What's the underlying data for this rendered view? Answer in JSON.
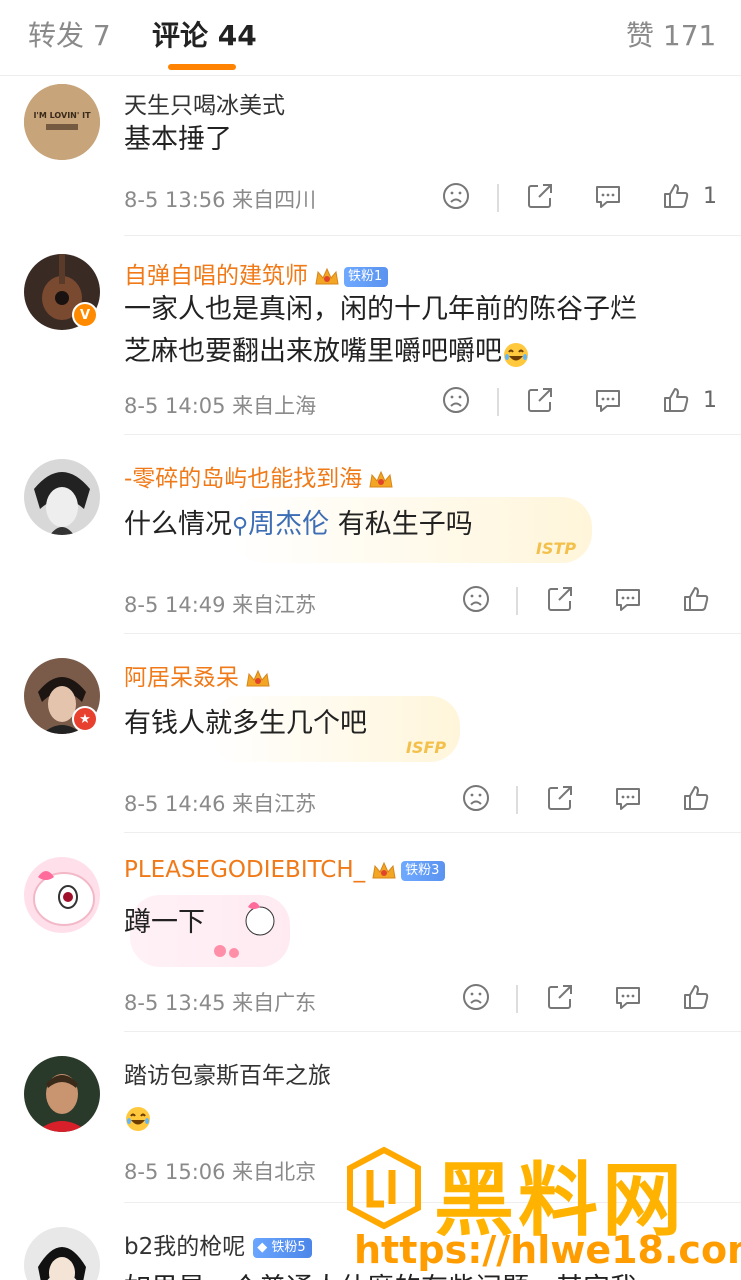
{
  "tabs": {
    "repost": "转发 7",
    "comments": "评论 44",
    "likes": "赞 171"
  },
  "comments": [
    {
      "name": "天生只喝冰美式",
      "body": "基本捶了",
      "meta": "8-5 13:56  来自四川",
      "likes": "1",
      "avatar_text": "I'M LOVIN' IT"
    },
    {
      "name": "自弹自唱的建筑师",
      "badge": "铁粉1",
      "body_line1": "一家人也是真闲，闲的十几年前的陈谷子烂",
      "body_line2": "芝麻也要翻出来放嘴里嚼吧嚼吧",
      "meta": "8-5 14:05  来自上海",
      "likes": "1",
      "avatar_badge": "V"
    },
    {
      "name": "-零碎的岛屿也能找到海",
      "body_pre": "什么情况",
      "topic": "周杰伦",
      "body_post": " 有私生子吗",
      "meta": "8-5 14:49  来自江苏",
      "mbti": "ISTP"
    },
    {
      "name": "阿居呆叒呆",
      "body": "有钱人就多生几个吧",
      "meta": "8-5 14:46  来自江苏",
      "mbti": "ISFP"
    },
    {
      "name": "PLEASEGODIEBITCH_",
      "badge": "铁粉3",
      "body": "蹲一下",
      "meta": "8-5 13:45  来自广东"
    },
    {
      "name": "踏访包豪斯百年之旅",
      "meta": "8-5 15:06  来自北京"
    },
    {
      "name": "b2我的枪呢",
      "badge": "铁粉5",
      "body_partial": "如果是一个普通人什麽的有些问题，其实我"
    }
  ],
  "watermark": {
    "title": "黑料网",
    "url": "https://hlwe18.com"
  },
  "colors": {
    "accent": "#ff8200",
    "name_orange": "#f07a18",
    "topic_blue": "#3d6eb5",
    "meta_gray": "#8a8a8a"
  }
}
